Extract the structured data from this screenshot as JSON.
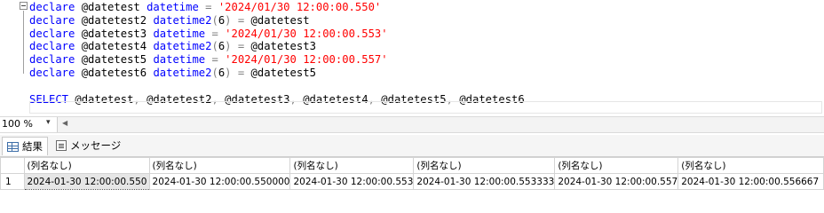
{
  "editor": {
    "lines": [
      [
        {
          "t": "declare",
          "c": "kw"
        },
        {
          "t": " @datetest ",
          "c": "id"
        },
        {
          "t": "datetime",
          "c": "kw"
        },
        {
          "t": " = ",
          "c": "op"
        },
        {
          "t": "'2024/01/30 12:00:00.550'",
          "c": "str"
        }
      ],
      [
        {
          "t": "declare",
          "c": "kw"
        },
        {
          "t": " @datetest2 ",
          "c": "id"
        },
        {
          "t": "datetime2",
          "c": "kw"
        },
        {
          "t": "(",
          "c": "op"
        },
        {
          "t": "6",
          "c": "id"
        },
        {
          "t": ")",
          "c": "op"
        },
        {
          "t": " = ",
          "c": "op"
        },
        {
          "t": "@datetest",
          "c": "id"
        }
      ],
      [
        {
          "t": "declare",
          "c": "kw"
        },
        {
          "t": " @datetest3 ",
          "c": "id"
        },
        {
          "t": "datetime",
          "c": "kw"
        },
        {
          "t": " = ",
          "c": "op"
        },
        {
          "t": "'2024/01/30 12:00:00.553'",
          "c": "str"
        }
      ],
      [
        {
          "t": "declare",
          "c": "kw"
        },
        {
          "t": " @datetest4 ",
          "c": "id"
        },
        {
          "t": "datetime2",
          "c": "kw"
        },
        {
          "t": "(",
          "c": "op"
        },
        {
          "t": "6",
          "c": "id"
        },
        {
          "t": ")",
          "c": "op"
        },
        {
          "t": " = ",
          "c": "op"
        },
        {
          "t": "@datetest3",
          "c": "id"
        }
      ],
      [
        {
          "t": "declare",
          "c": "kw"
        },
        {
          "t": " @datetest5 ",
          "c": "id"
        },
        {
          "t": "datetime",
          "c": "kw"
        },
        {
          "t": " = ",
          "c": "op"
        },
        {
          "t": "'2024/01/30 12:00:00.557'",
          "c": "str"
        }
      ],
      [
        {
          "t": "declare",
          "c": "kw"
        },
        {
          "t": " @datetest6 ",
          "c": "id"
        },
        {
          "t": "datetime2",
          "c": "kw"
        },
        {
          "t": "(",
          "c": "op"
        },
        {
          "t": "6",
          "c": "id"
        },
        {
          "t": ")",
          "c": "op"
        },
        {
          "t": " = ",
          "c": "op"
        },
        {
          "t": "@datetest5",
          "c": "id"
        }
      ],
      [],
      [
        {
          "t": "SELECT",
          "c": "kw"
        },
        {
          "t": " @datetest",
          "c": "id"
        },
        {
          "t": ",",
          "c": "op"
        },
        {
          "t": " @datetest2",
          "c": "id"
        },
        {
          "t": ",",
          "c": "op"
        },
        {
          "t": " @datetest3",
          "c": "id"
        },
        {
          "t": ",",
          "c": "op"
        },
        {
          "t": " @datetest4",
          "c": "id"
        },
        {
          "t": ",",
          "c": "op"
        },
        {
          "t": " @datetest5",
          "c": "id"
        },
        {
          "t": ",",
          "c": "op"
        },
        {
          "t": " @datetest6",
          "c": "id"
        }
      ]
    ]
  },
  "zoom": {
    "value": "100 %",
    "arrow": "▾",
    "scroll_left": "◀"
  },
  "tabs": {
    "results": "結果",
    "messages": "メッセージ"
  },
  "results": {
    "headers": [
      "(列名なし)",
      "(列名なし)",
      "(列名なし)",
      "(列名なし)",
      "(列名なし)",
      "(列名なし)"
    ],
    "rows": [
      {
        "num": "1",
        "cells": [
          "2024-01-30 12:00:00.550",
          "2024-01-30 12:00:00.550000",
          "2024-01-30 12:00:00.553",
          "2024-01-30 12:00:00.553333",
          "2024-01-30 12:00:00.557",
          "2024-01-30 12:00:00.556667"
        ]
      }
    ]
  },
  "colors": {
    "keyword": "#0000ff",
    "string": "#ff0000",
    "operator": "#808080"
  }
}
